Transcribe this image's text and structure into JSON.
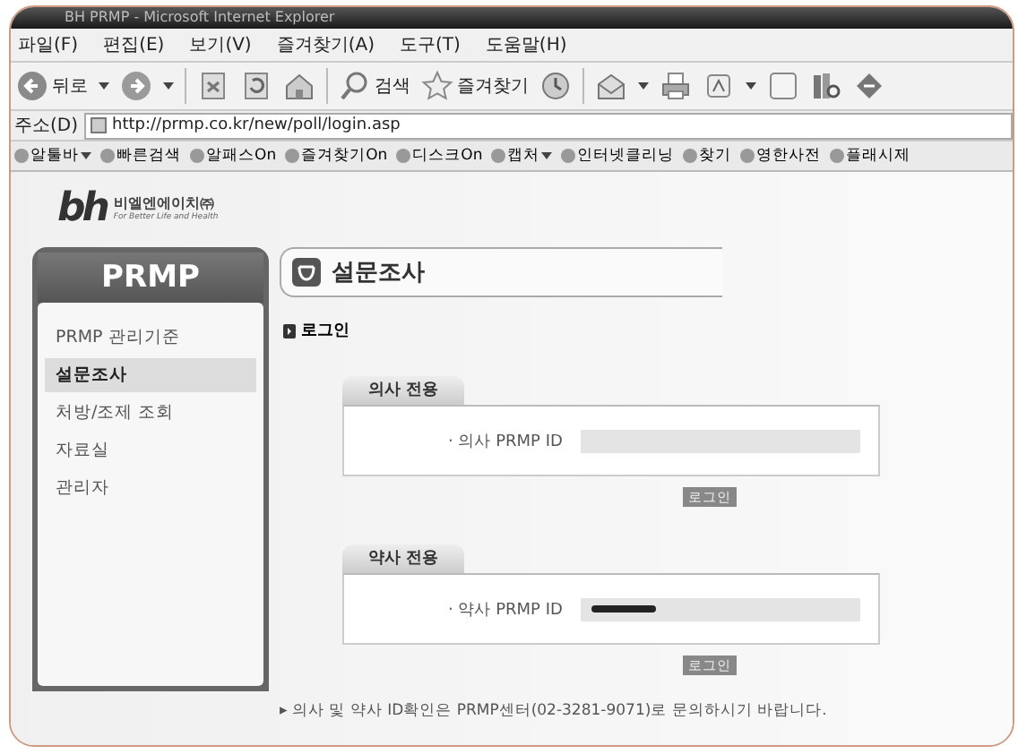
{
  "window": {
    "title": "BH PRMP - Microsoft Internet Explorer"
  },
  "menu": [
    "파일(F)",
    "편집(E)",
    "보기(V)",
    "즐겨찾기(A)",
    "도구(T)",
    "도움말(H)"
  ],
  "toolbar": [
    {
      "kind": "back",
      "label": "뒤로",
      "has_menu": true
    },
    {
      "kind": "forward",
      "has_menu": true
    },
    {
      "kind": "stop",
      "has_menu": false
    },
    {
      "kind": "refresh",
      "has_menu": false
    },
    {
      "kind": "home",
      "has_menu": false
    },
    {
      "kind": "search",
      "label": "검색",
      "has_menu": false
    },
    {
      "kind": "favorites",
      "label": "즐겨찾기",
      "has_menu": false
    },
    {
      "kind": "history",
      "has_menu": false
    },
    {
      "kind": "mail",
      "has_menu": true
    },
    {
      "kind": "print",
      "has_menu": false
    },
    {
      "kind": "edit",
      "has_menu": true
    },
    {
      "kind": "blank",
      "has_menu": false
    },
    {
      "kind": "research",
      "has_menu": false
    },
    {
      "kind": "messenger",
      "has_menu": false
    }
  ],
  "address": {
    "label": "주소(D)",
    "url": "http://prmp.co.kr/new/poll/login.asp"
  },
  "links": [
    {
      "label": "알툴바",
      "has_menu": true
    },
    {
      "label": "빠른검색",
      "has_menu": false
    },
    {
      "label": "알패스On",
      "has_menu": false
    },
    {
      "label": "즐겨찾기On",
      "has_menu": false
    },
    {
      "label": "디스크On",
      "has_menu": false
    },
    {
      "label": "캡처",
      "has_menu": true
    },
    {
      "label": "인터넷클리닝",
      "has_menu": false
    },
    {
      "label": "찾기",
      "has_menu": false
    },
    {
      "label": "영한사전",
      "has_menu": false
    },
    {
      "label": "플래시제",
      "has_menu": false
    }
  ],
  "logo": {
    "mark": "bh",
    "name": "비엘엔에이치㈜",
    "slogan": "For Better Life and Health"
  },
  "sidebar": {
    "title": "PRMP",
    "items": [
      {
        "label": "PRMP 관리기준",
        "selected": false
      },
      {
        "label": "설문조사",
        "selected": true
      },
      {
        "label": "처방/조제 조회",
        "selected": false
      },
      {
        "label": "자료실",
        "selected": false
      },
      {
        "label": "관리자",
        "selected": false
      }
    ]
  },
  "page_title": "설문조사",
  "section": "로그인",
  "panels": [
    {
      "tab": "의사 전용",
      "field_label": "· 의사 PRMP ID",
      "redacted": false,
      "button": "로그인"
    },
    {
      "tab": "약사 전용",
      "field_label": "· 약사 PRMP ID",
      "redacted": true,
      "button": "로그인"
    }
  ],
  "notice": "▸ 의사 및 약사 ID확인은 PRMP센터(02-3281-9071)로 문의하시기 바랍니다."
}
